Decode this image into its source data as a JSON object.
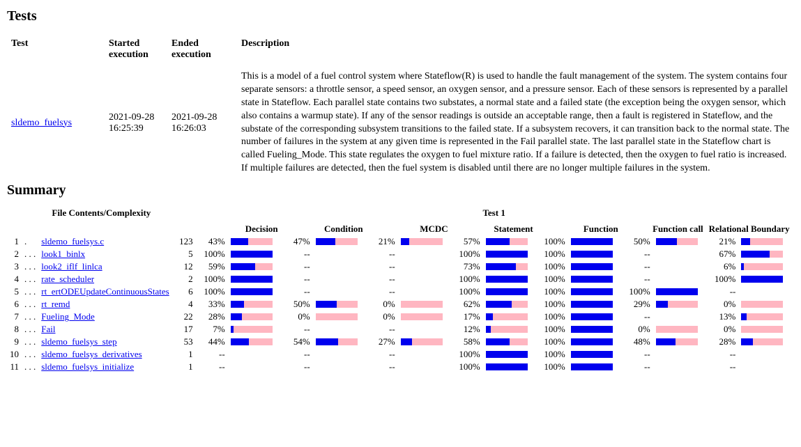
{
  "headings": {
    "tests": "Tests",
    "summary": "Summary"
  },
  "tests_table": {
    "headers": {
      "test": "Test",
      "started": "Started execution",
      "ended": "Ended execution",
      "description": "Description"
    },
    "rows": [
      {
        "test_link": "sldemo_fuelsys",
        "started": "2021-09-28 16:25:39",
        "ended": "2021-09-28 16:26:03",
        "description": "This is a model of a fuel control system where Stateflow(R) is used to handle the fault management of the system. The system contains four separate sensors: a throttle sensor, a speed sensor, an oxygen sensor, and a pressure sensor. Each of these sensors is represented by a parallel state in Stateflow. Each parallel state contains two substates, a normal state and a failed state (the exception being the oxygen sensor, which also contains a warmup state). If any of the sensor readings is outside an acceptable range, then a fault is registered in Stateflow, and the substate of the corresponding subsystem transitions to the failed state. If a subsystem recovers, it can transition back to the normal state. The number of failures in the system at any given time is represented in the Fail parallel state. The last parallel state in the Stateflow chart is called Fueling_Mode. This state regulates the oxygen to fuel mixture ratio. If a failure is detected, then the oxygen to fuel ratio is increased. If multiple failures are detected, then the fuel system is disabled until there are no longer multiple failures in the system."
      }
    ]
  },
  "summary": {
    "top_headers": {
      "file": "File Contents/Complexity",
      "test": "Test 1"
    },
    "metric_headers": [
      "Decision",
      "Condition",
      "MCDC",
      "Statement",
      "Function",
      "Function call",
      "Relational Boundary"
    ],
    "rows": [
      {
        "idx": "1",
        "dots": ".",
        "name": "sldemo_fuelsys.c",
        "cx": "123",
        "m": [
          {
            "p": "43%",
            "b": 43
          },
          {
            "p": "47%",
            "b": 47
          },
          {
            "p": "21%",
            "b": 21
          },
          {
            "p": "57%",
            "b": 57
          },
          {
            "p": "100%",
            "b": 100
          },
          {
            "p": "50%",
            "b": 50
          },
          {
            "p": "21%",
            "b": 21
          }
        ]
      },
      {
        "idx": "2",
        "dots": ". . .",
        "name": "look1_binlx",
        "cx": "5",
        "m": [
          {
            "p": "100%",
            "b": 100,
            "cyan": true
          },
          {
            "p": "--"
          },
          {
            "p": "--"
          },
          {
            "p": "100%",
            "b": 100,
            "cyan": true
          },
          {
            "p": "100%",
            "b": 100
          },
          {
            "p": "--"
          },
          {
            "p": "67%",
            "b": 67
          }
        ]
      },
      {
        "idx": "3",
        "dots": ". . .",
        "name": "look2_iflf_linlca",
        "cx": "12",
        "m": [
          {
            "p": "59%",
            "b": 59
          },
          {
            "p": "--"
          },
          {
            "p": "--"
          },
          {
            "p": "73%",
            "b": 73
          },
          {
            "p": "100%",
            "b": 100
          },
          {
            "p": "--"
          },
          {
            "p": "6%",
            "b": 6
          }
        ]
      },
      {
        "idx": "4",
        "dots": ". . .",
        "name": "rate_scheduler",
        "cx": "2",
        "m": [
          {
            "p": "100%",
            "b": 100
          },
          {
            "p": "--"
          },
          {
            "p": "--"
          },
          {
            "p": "100%",
            "b": 100
          },
          {
            "p": "100%",
            "b": 100
          },
          {
            "p": "--"
          },
          {
            "p": "100%",
            "b": 100
          }
        ]
      },
      {
        "idx": "5",
        "dots": ". . .",
        "name": "rt_ertODEUpdateContinuousStates",
        "cx": "6",
        "m": [
          {
            "p": "100%",
            "b": 100
          },
          {
            "p": "--"
          },
          {
            "p": "--"
          },
          {
            "p": "100%",
            "b": 100
          },
          {
            "p": "100%",
            "b": 100
          },
          {
            "p": "100%",
            "b": 100
          },
          {
            "p": "--"
          }
        ]
      },
      {
        "idx": "6",
        "dots": ". . .",
        "name": "rt_remd",
        "cx": "4",
        "m": [
          {
            "p": "33%",
            "b": 33
          },
          {
            "p": "50%",
            "b": 50
          },
          {
            "p": "0%",
            "b": 0
          },
          {
            "p": "62%",
            "b": 62
          },
          {
            "p": "100%",
            "b": 100
          },
          {
            "p": "29%",
            "b": 29
          },
          {
            "p": "0%",
            "b": 0
          }
        ]
      },
      {
        "idx": "7",
        "dots": ". . .",
        "name": "Fueling_Mode",
        "cx": "22",
        "m": [
          {
            "p": "28%",
            "b": 28
          },
          {
            "p": "0%",
            "b": 0
          },
          {
            "p": "0%",
            "b": 0
          },
          {
            "p": "17%",
            "b": 17
          },
          {
            "p": "100%",
            "b": 100
          },
          {
            "p": "--"
          },
          {
            "p": "13%",
            "b": 13
          }
        ]
      },
      {
        "idx": "8",
        "dots": ". . .",
        "name": "Fail",
        "cx": "17",
        "m": [
          {
            "p": "7%",
            "b": 7
          },
          {
            "p": "--"
          },
          {
            "p": "--"
          },
          {
            "p": "12%",
            "b": 12
          },
          {
            "p": "100%",
            "b": 100
          },
          {
            "p": "0%",
            "b": 0
          },
          {
            "p": "0%",
            "b": 0
          }
        ]
      },
      {
        "idx": "9",
        "dots": ". . .",
        "name": "sldemo_fuelsys_step",
        "cx": "53",
        "m": [
          {
            "p": "44%",
            "b": 44
          },
          {
            "p": "54%",
            "b": 54
          },
          {
            "p": "27%",
            "b": 27
          },
          {
            "p": "58%",
            "b": 58
          },
          {
            "p": "100%",
            "b": 100
          },
          {
            "p": "48%",
            "b": 48
          },
          {
            "p": "28%",
            "b": 28
          }
        ]
      },
      {
        "idx": "10",
        "dots": ". . .",
        "name": "sldemo_fuelsys_derivatives",
        "cx": "1",
        "m": [
          {
            "p": "--"
          },
          {
            "p": "--"
          },
          {
            "p": "--"
          },
          {
            "p": "100%",
            "b": 100
          },
          {
            "p": "100%",
            "b": 100
          },
          {
            "p": "--"
          },
          {
            "p": "--"
          }
        ]
      },
      {
        "idx": "11",
        "dots": ". . .",
        "name": "sldemo_fuelsys_initialize",
        "cx": "1",
        "m": [
          {
            "p": "--"
          },
          {
            "p": "--"
          },
          {
            "p": "--"
          },
          {
            "p": "100%",
            "b": 100
          },
          {
            "p": "100%",
            "b": 100
          },
          {
            "p": "--"
          },
          {
            "p": "--"
          }
        ]
      }
    ]
  },
  "chart_data": {
    "type": "table",
    "title": "Code Coverage Summary — Test 1",
    "columns": [
      "File",
      "Complexity",
      "Decision",
      "Condition",
      "MCDC",
      "Statement",
      "Function",
      "Function call",
      "Relational Boundary"
    ],
    "rows": [
      [
        "sldemo_fuelsys.c",
        123,
        43,
        47,
        21,
        57,
        100,
        50,
        21
      ],
      [
        "look1_binlx",
        5,
        100,
        null,
        null,
        100,
        100,
        null,
        67
      ],
      [
        "look2_iflf_linlca",
        12,
        59,
        null,
        null,
        73,
        100,
        null,
        6
      ],
      [
        "rate_scheduler",
        2,
        100,
        null,
        null,
        100,
        100,
        null,
        100
      ],
      [
        "rt_ertODEUpdateContinuousStates",
        6,
        100,
        null,
        null,
        100,
        100,
        100,
        null
      ],
      [
        "rt_remd",
        4,
        33,
        50,
        0,
        62,
        100,
        29,
        0
      ],
      [
        "Fueling_Mode",
        22,
        28,
        0,
        0,
        17,
        100,
        null,
        13
      ],
      [
        "Fail",
        17,
        7,
        null,
        null,
        12,
        100,
        0,
        0
      ],
      [
        "sldemo_fuelsys_step",
        53,
        44,
        54,
        27,
        58,
        100,
        48,
        28
      ],
      [
        "sldemo_fuelsys_derivatives",
        1,
        null,
        null,
        null,
        100,
        100,
        null,
        null
      ],
      [
        "sldemo_fuelsys_initialize",
        1,
        null,
        null,
        null,
        100,
        100,
        null,
        null
      ]
    ],
    "units": "percent",
    "value_range": [
      0,
      100
    ]
  }
}
